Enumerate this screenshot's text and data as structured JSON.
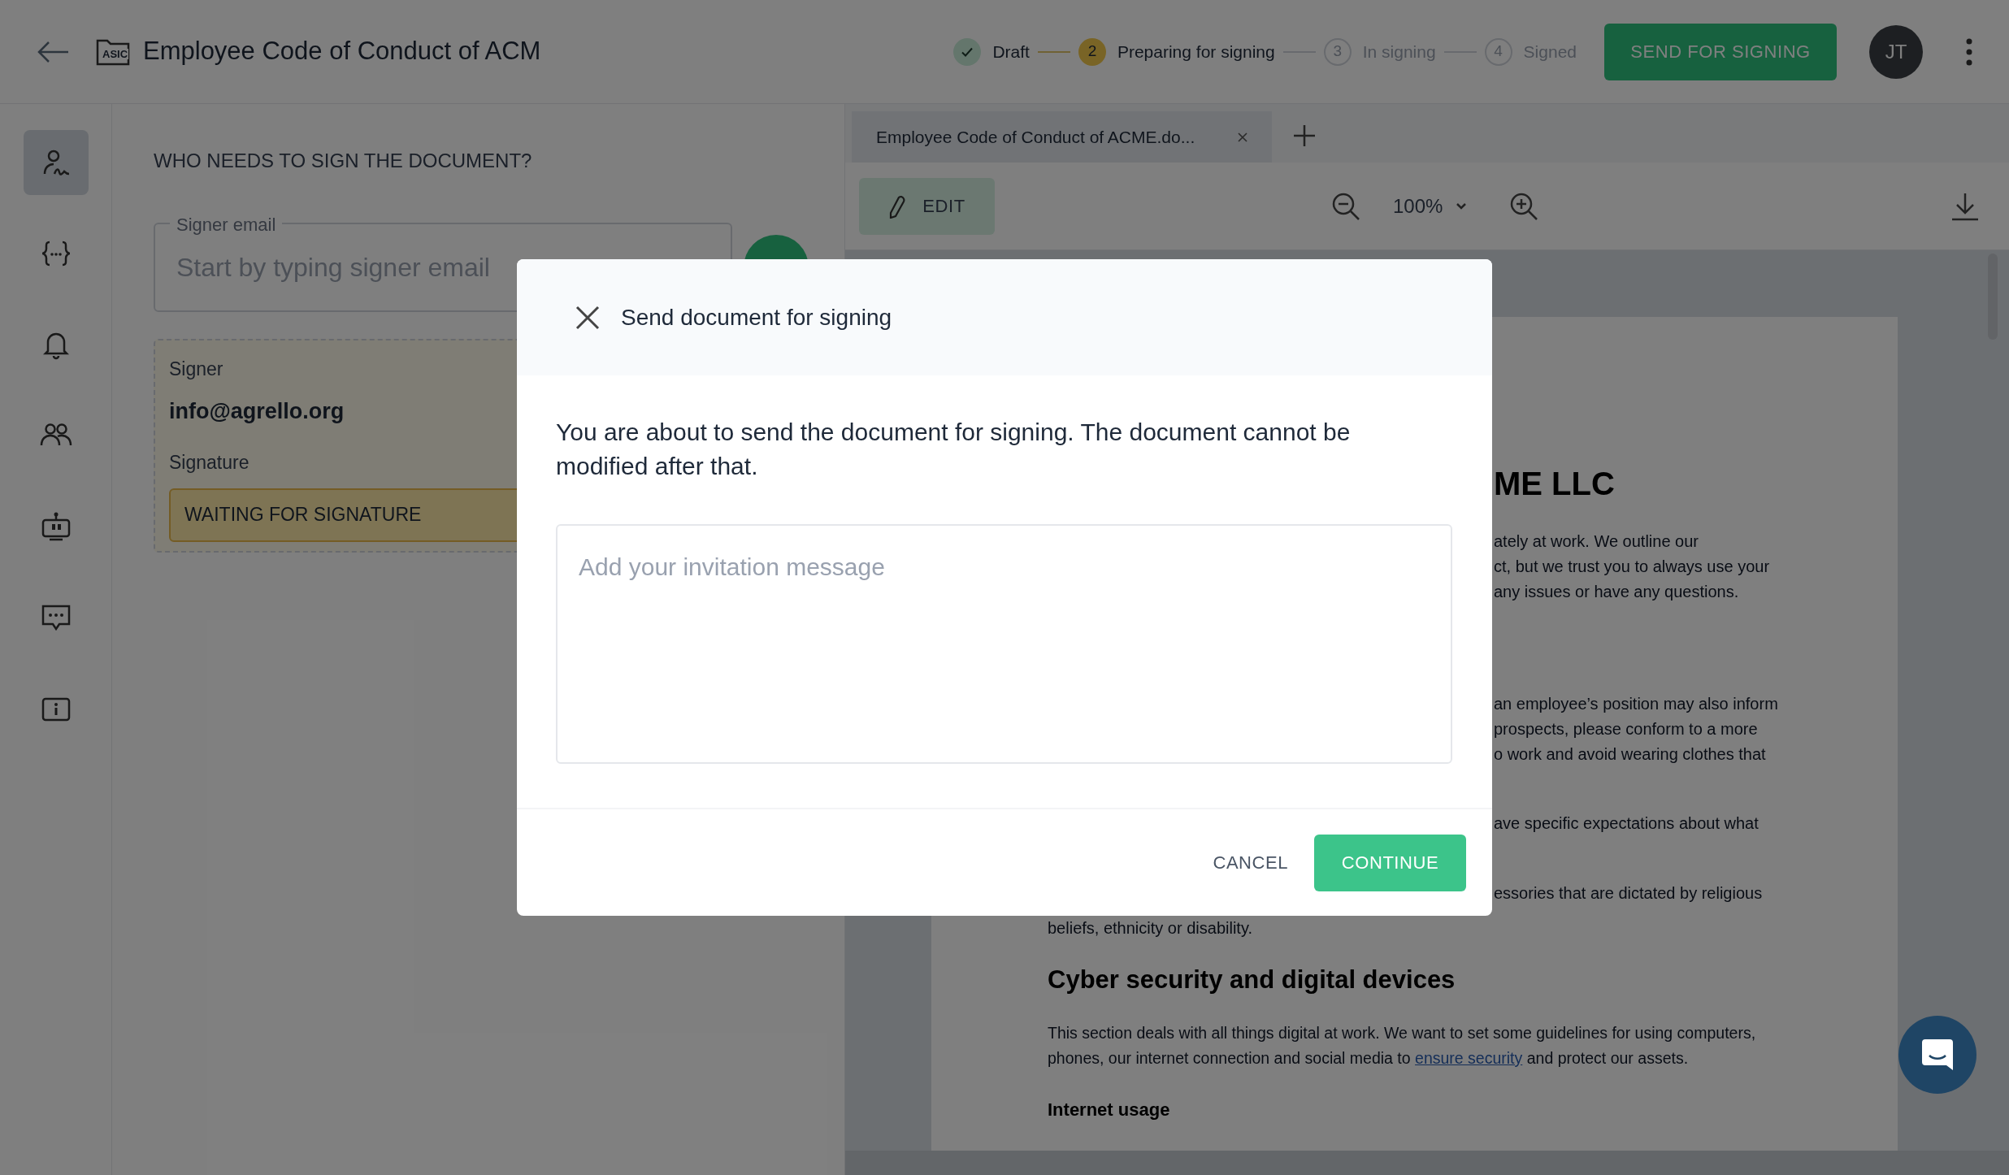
{
  "header": {
    "title": "Employee Code of Conduct of ACM",
    "file_badge": "ASIC",
    "steps": [
      {
        "label": "Draft",
        "done": true,
        "active": false
      },
      {
        "number": "2",
        "label": "Preparing for signing",
        "done": false,
        "active": true
      },
      {
        "number": "3",
        "label": "In signing",
        "done": false,
        "active": false
      },
      {
        "number": "4",
        "label": "Signed",
        "done": false,
        "active": false
      }
    ],
    "send_button": "SEND FOR SIGNING",
    "avatar": "JT"
  },
  "rail": [
    {
      "selected": true
    },
    {
      "selected": false
    },
    {
      "selected": false
    },
    {
      "selected": false
    },
    {
      "selected": false
    },
    {
      "selected": false
    },
    {
      "selected": false
    }
  ],
  "signers_panel": {
    "heading": "WHO NEEDS TO SIGN THE DOCUMENT?",
    "email_label": "Signer email",
    "email_placeholder": "Start by typing signer email",
    "signer": {
      "label": "Signer",
      "email": "info@agrello.org",
      "signature_label": "Signature",
      "status": "WAITING FOR SIGNATURE"
    }
  },
  "viewer": {
    "tabs": [
      {
        "label": "Employee Code of Conduct of ACME.do...",
        "selected": true
      }
    ],
    "edit_button": "EDIT",
    "zoom": "100%",
    "blocks": [
      {
        "kind": "title",
        "lines": [
          "ME LLC"
        ]
      },
      {
        "kind": "cut_paragraph",
        "lines": [
          "ately at work. We outline our",
          "ct, but we trust you to always use your",
          "any issues or have any questions."
        ]
      },
      {
        "kind": "cut_paragraph",
        "lines": [
          "an employee’s position may also inform",
          "prospects, please conform to a more",
          "o work and avoid wearing clothes that"
        ]
      },
      {
        "kind": "cut_paragraph",
        "lines": [
          "ave specific expectations about what"
        ]
      },
      {
        "kind": "cut_paragraph",
        "lines": [
          "essories that are dictated by religious"
        ]
      },
      {
        "kind": "paragraph",
        "lines": [
          "beliefs, ethnicity or disability."
        ]
      },
      {
        "kind": "heading",
        "text": "Cyber security and digital devices"
      },
      {
        "kind": "link_paragraph",
        "before": "This section deals with all things digital at work. We want to set some guidelines for using computers, phones, our internet connection and social media to",
        "link": "ensure security",
        "after": "and protect our assets."
      },
      {
        "kind": "subheading",
        "text": "Internet usage"
      }
    ]
  },
  "dialog": {
    "title": "Send document for signing",
    "message": "You are about to send the document for signing. The document cannot be modified after that.",
    "placeholder": "Add your invitation message",
    "cancel": "CANCEL",
    "continue": "CONTINUE"
  }
}
